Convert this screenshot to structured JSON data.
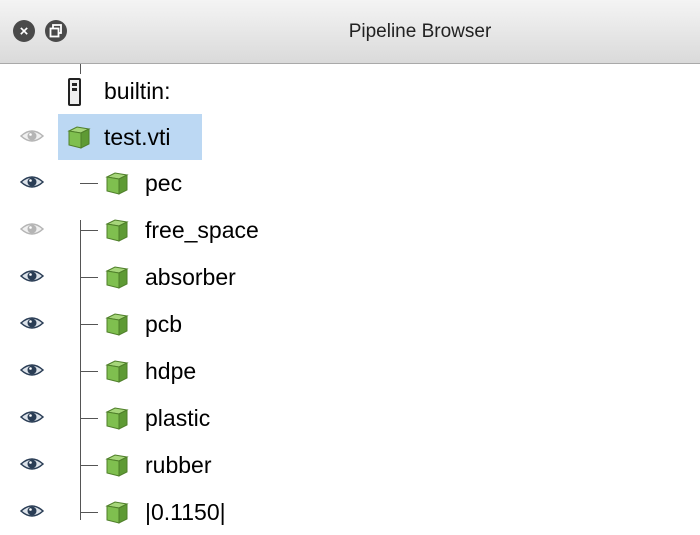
{
  "window": {
    "title": "Pipeline Browser",
    "close_icon": "close-x-icon",
    "float_icon": "undock-icon"
  },
  "colors": {
    "selection": "#bcd8f3",
    "cube_green": "#7fbf4f",
    "eye_visible": "#2a3d55",
    "eye_hidden": "#b5b5b5"
  },
  "server": {
    "label": "builtin:",
    "icon": "server-icon"
  },
  "root": {
    "label": "test.vti",
    "visible": false,
    "selected": true,
    "icon": "cube-icon"
  },
  "children": [
    {
      "label": "pec",
      "visible": true
    },
    {
      "label": "free_space",
      "visible": false
    },
    {
      "label": "absorber",
      "visible": true
    },
    {
      "label": "pcb",
      "visible": true
    },
    {
      "label": "hdpe",
      "visible": true
    },
    {
      "label": "plastic",
      "visible": true
    },
    {
      "label": "rubber",
      "visible": true
    },
    {
      "label": "|0.1150|",
      "visible": true
    }
  ]
}
